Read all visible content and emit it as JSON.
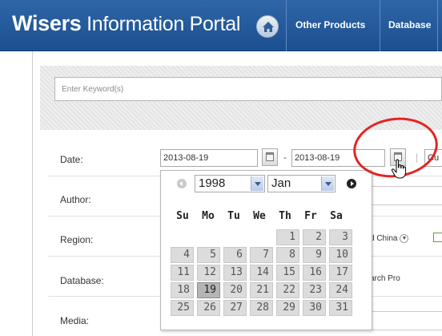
{
  "header": {
    "title_brand": "Wisers",
    "title_rest": " Information Portal",
    "home_icon": "home-icon",
    "nav": [
      {
        "label": "Other Products"
      },
      {
        "label": "Database"
      }
    ],
    "bg_color": "#1b4f8f"
  },
  "search": {
    "keyword_placeholder": "Enter Keyword(s)",
    "keyword_value": ""
  },
  "form": {
    "labels": {
      "date": "Date:",
      "author": "Author:",
      "region": "Region:",
      "database": "Database:",
      "media": "Media:"
    },
    "date_from": "2013-08-19",
    "date_separator": "-",
    "date_to": "2013-08-19",
    "pipe": "|",
    "right_partial": "Cu",
    "region_partial": "d China",
    "database_partial": "arch Pro"
  },
  "calendar": {
    "year": "1998",
    "month": "Jan",
    "weekdays": [
      "Su",
      "Mo",
      "Tu",
      "We",
      "Th",
      "Fr",
      "Sa"
    ],
    "weeks": [
      [
        "",
        "",
        "",
        "",
        "1",
        "2",
        "3"
      ],
      [
        "4",
        "5",
        "6",
        "7",
        "8",
        "9",
        "10"
      ],
      [
        "11",
        "12",
        "13",
        "14",
        "15",
        "16",
        "17"
      ],
      [
        "18",
        "19",
        "20",
        "21",
        "22",
        "23",
        "24"
      ],
      [
        "25",
        "26",
        "27",
        "28",
        "29",
        "30",
        "31"
      ]
    ],
    "selected_day": "19",
    "prev_icon": "prev-month-icon",
    "next_icon": "next-month-icon"
  },
  "annotation": {
    "ring_color": "#e32424"
  }
}
